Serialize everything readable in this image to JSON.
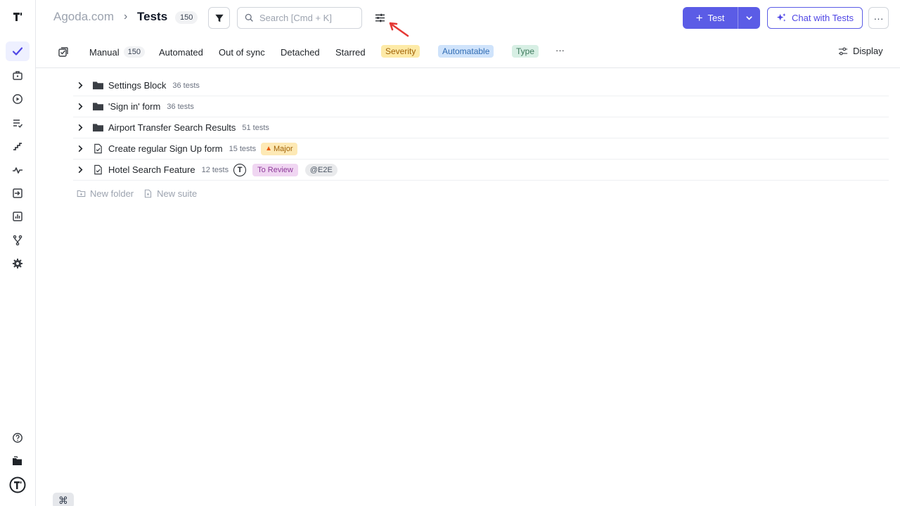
{
  "header": {
    "project": "Agoda.com",
    "separator": "›",
    "title": "Tests",
    "count": "150",
    "search_placeholder": "Search [Cmd + K]",
    "test_button": "Test",
    "chat_button": "Chat with Tests",
    "more_button": "···"
  },
  "tabs": {
    "manual": "Manual",
    "manual_count": "150",
    "automated": "Automated",
    "out_of_sync": "Out of sync",
    "detached": "Detached",
    "starred": "Starred",
    "severity": "Severity",
    "automatable": "Automatable",
    "type": "Type",
    "more": "···",
    "display": "Display"
  },
  "tree": {
    "rows": [
      {
        "name": "Settings Block",
        "count": "36 tests",
        "kind": "folder"
      },
      {
        "name": "'Sign in' form",
        "count": "36 tests",
        "kind": "folder"
      },
      {
        "name": "Airport Transfer Search Results",
        "count": "51 tests",
        "kind": "folder"
      },
      {
        "name": "Create regular Sign Up form",
        "count": "15 tests",
        "kind": "suite",
        "badge": "Major"
      },
      {
        "name": "Hotel Search Feature",
        "count": "12 tests",
        "kind": "suite",
        "avatar": "T",
        "status": "To Review",
        "tag": "@E2E"
      }
    ],
    "new_folder": "New folder",
    "new_suite": "New suite"
  },
  "shortcut": "⌘",
  "colors": {
    "accent": "#5b5ce6",
    "severity_bg": "#fdeaa7",
    "automatable_bg": "#cfe3fb",
    "type_bg": "#d7efe4",
    "review_bg": "#f0d6f2",
    "annotation_arrow": "#e53935"
  }
}
